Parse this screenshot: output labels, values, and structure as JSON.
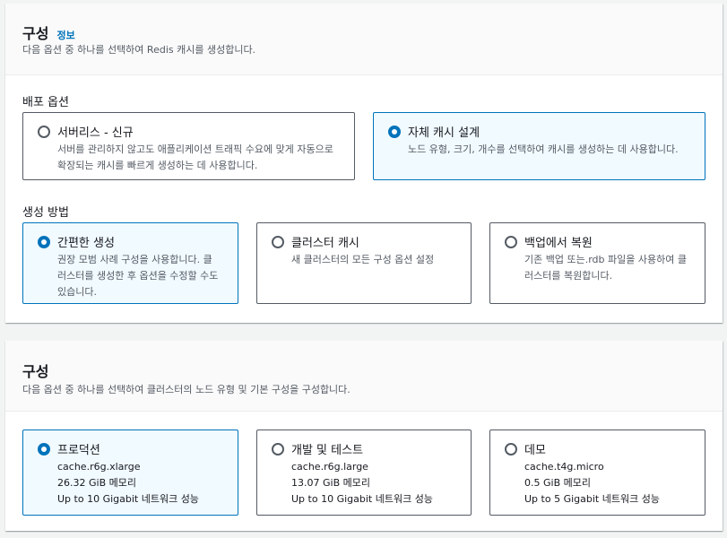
{
  "section1": {
    "title": "구성",
    "info_link": "정보",
    "description": "다음 옵션 중 하나를 선택하여 Redis 캐시를 생성합니다.",
    "deploy_options_label": "배포 옵션",
    "deploy_options": [
      {
        "title": "서버리스 - 신규",
        "desc": [
          "서버를 관리하지 않고도 애플리케이션 트래픽 수요에 맞게 자동으로",
          "확장되는 캐시를 빠르게 생성하는 데 사용합니다."
        ],
        "selected": false
      },
      {
        "title": "자체 캐시 설계",
        "desc": [
          "노드 유형, 크기, 개수를 선택하여 캐시를 생성하는 데 사용합니다."
        ],
        "selected": true
      }
    ],
    "creation_method_label": "생성 방법",
    "creation_methods": [
      {
        "title": "간편한 생성",
        "desc": [
          "권장 모범 사례 구성을 사용합니다. 클",
          "러스터를 생성한 후 옵션을 수정할 수도",
          "있습니다."
        ],
        "selected": true
      },
      {
        "title": "클러스터 캐시",
        "desc": [
          "새 클러스터의 모든 구성 옵션 설정"
        ],
        "selected": false
      },
      {
        "title": "백업에서 복원",
        "desc": [
          "기존 백업 또는.rdb 파일을 사용하여 클",
          "러스터를 복원합니다."
        ],
        "selected": false
      }
    ]
  },
  "section2": {
    "title": "구성",
    "description": "다음 옵션 중 하나를 선택하여 클러스터의 노드 유형 및 기본 구성을 구성합니다.",
    "configurations": [
      {
        "title": "프로덕션",
        "node_type": "cache.r6g.xlarge",
        "memory": "26.32 GiB 메모리",
        "network": "Up to 10 Gigabit 네트워크 성능",
        "selected": true
      },
      {
        "title": "개발 및 테스트",
        "node_type": "cache.r6g.large",
        "memory": "13.07 GiB 메모리",
        "network": "Up to 10 Gigabit 네트워크 성능",
        "selected": false
      },
      {
        "title": "데모",
        "node_type": "cache.t4g.micro",
        "memory": "0.5 GiB 메모리",
        "network": "Up to 5 Gigabit 네트워크 성능",
        "selected": false
      }
    ]
  },
  "colors": {
    "accent": "#0073bb",
    "selected_bg": "#f1faff",
    "border": "#545b64",
    "page_bg": "#f2f3f3"
  }
}
